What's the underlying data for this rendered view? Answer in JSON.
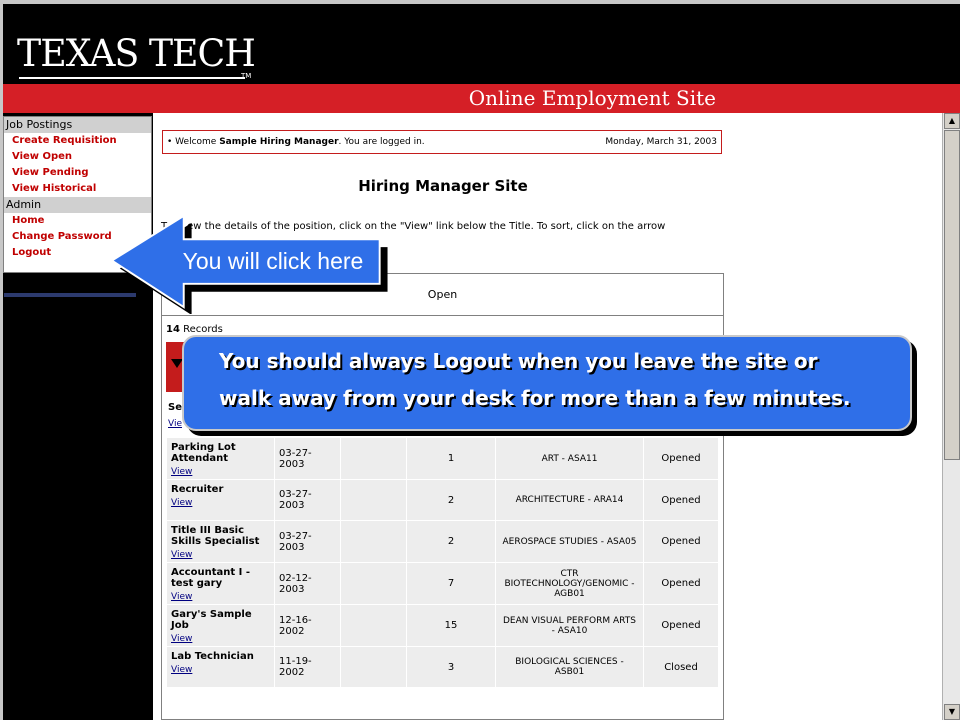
{
  "brand": {
    "logo_text": "TEXAS TECH",
    "logo_tm": "TM",
    "site_title": "Online Employment Site",
    "colors": {
      "red": "#d51f26",
      "black": "#000000",
      "callout_blue": "#2f6fe8"
    }
  },
  "sidebar": {
    "sections": [
      {
        "header": "Job Postings",
        "items": [
          {
            "label": "Create Requisition"
          },
          {
            "label": "View Open"
          },
          {
            "label": "View Pending"
          },
          {
            "label": "View Historical"
          }
        ]
      },
      {
        "header": "Admin",
        "items": [
          {
            "label": "Home"
          },
          {
            "label": "Change Password"
          },
          {
            "label": "Logout"
          }
        ]
      }
    ]
  },
  "welcome": {
    "prefix": "• Welcome ",
    "user": "Sample Hiring Manager",
    "suffix": ". You are logged in.",
    "date": "Monday, March 31, 2003"
  },
  "page": {
    "title": "Hiring Manager Site",
    "instructions_visible": "T",
    "instructions_rest": "ew the details of the position, click on the \"View\" link below the Title. To sort, click on the arrow",
    "table_heading": "Open",
    "records_count": "14",
    "records_label": " Records",
    "partial_title": "Se",
    "partial_view": "Vie"
  },
  "jobs": [
    {
      "title": "Parking Lot Attendant",
      "view": "View",
      "date": "03-27-2003",
      "num": "1",
      "dept": "ART - ASA11",
      "status": "Opened"
    },
    {
      "title": "Recruiter",
      "view": "View",
      "date": "03-27-2003",
      "num": "2",
      "dept": "ARCHITECTURE - ARA14",
      "status": "Opened"
    },
    {
      "title": "Title III Basic Skills Specialist",
      "view": "View",
      "date": "03-27-2003",
      "num": "2",
      "dept": "AEROSPACE STUDIES - ASA05",
      "status": "Opened"
    },
    {
      "title": "Accountant I - test gary",
      "view": "View",
      "date": "02-12-2003",
      "num": "7",
      "dept": "CTR BIOTECHNOLOGY/GENOMIC - AGB01",
      "status": "Opened"
    },
    {
      "title": "Gary's Sample Job",
      "view": "View",
      "date": "12-16-2002",
      "num": "15",
      "dept": "DEAN VISUAL PERFORM ARTS - ASA10",
      "status": "Opened"
    },
    {
      "title": "Lab Technician",
      "view": "View",
      "date": "11-19-2002",
      "num": "3",
      "dept": "BIOLOGICAL SCIENCES - ASB01",
      "status": "Closed"
    }
  ],
  "callouts": {
    "arrow_label": "You will click here",
    "note_line1": "You should always Logout when you leave the site or",
    "note_line2": "walk away from your desk for more than a few minutes."
  }
}
